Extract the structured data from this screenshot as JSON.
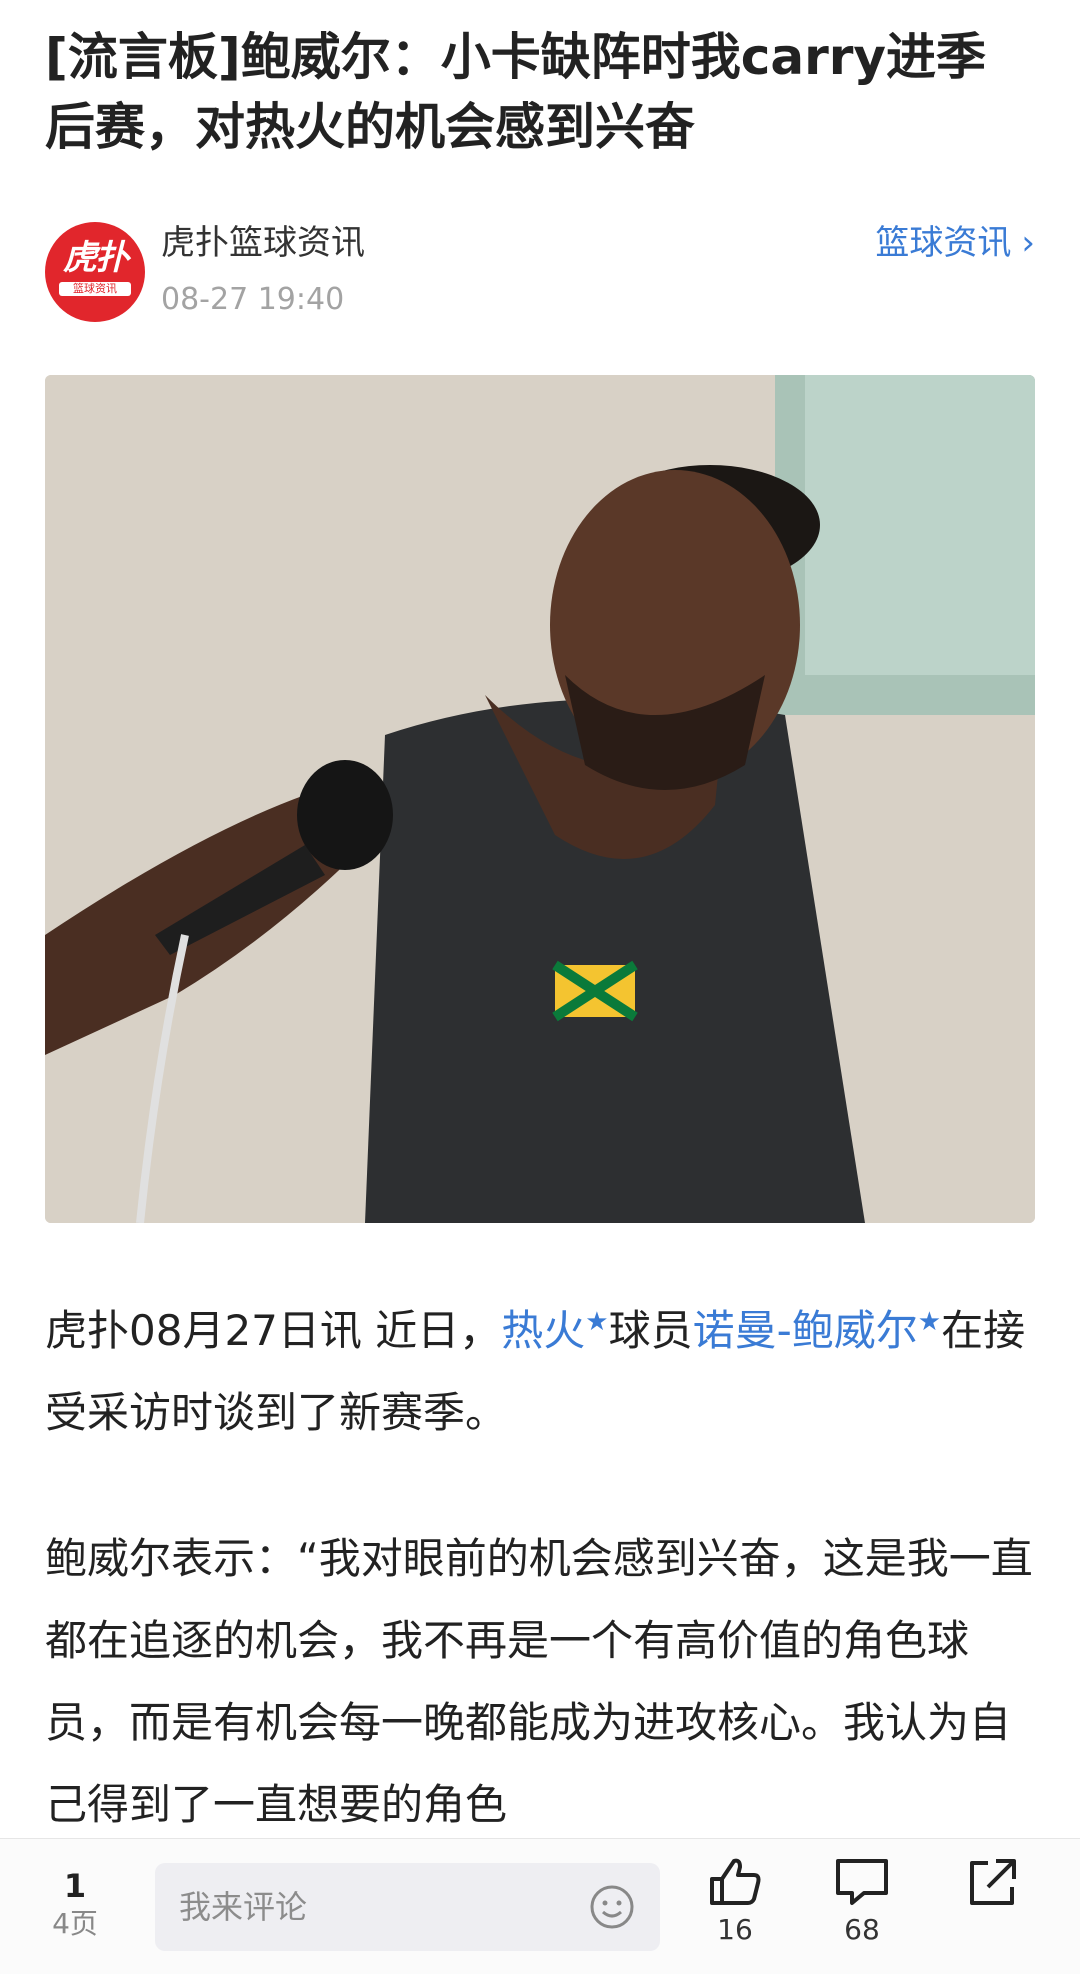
{
  "article": {
    "title": "[流言板]鲍威尔：小卡缺阵时我carry进季后赛，对热火的机会感到兴奋"
  },
  "source": {
    "avatar_text_big": "虎扑",
    "avatar_text_small": "篮球资讯",
    "name": "虎扑篮球资讯",
    "time": "08-27 19:40",
    "channel_label": "篮球资讯",
    "channel_chevron": "›"
  },
  "content": {
    "p1_prefix": "虎扑08月27日讯 近日，",
    "p1_link1": "热火",
    "p1_mid": "球员",
    "p1_link2": "诺曼-鲍威尔",
    "p1_suffix": "在接受采访时谈到了新赛季。",
    "p2": "鲍威尔表示：“我对眼前的机会感到兴奋，这是我一直都在追逐的机会，我不再是一个有高价值的角色球员，而是有机会每一晚都能成为进攻核心。我认为自己得到了一直想要的角色"
  },
  "bottom_bar": {
    "page_current": "1",
    "page_total": "4页",
    "comment_placeholder": "我来评论",
    "like_count": "16",
    "comment_count": "68"
  },
  "icons": {
    "smile": "smile-icon",
    "like": "thumbs-up-icon",
    "comment": "comment-bubble-icon",
    "share": "share-icon"
  },
  "colors": {
    "link": "#3a7bd5",
    "brand_red": "#e1262c",
    "muted": "#a3a3a3"
  }
}
